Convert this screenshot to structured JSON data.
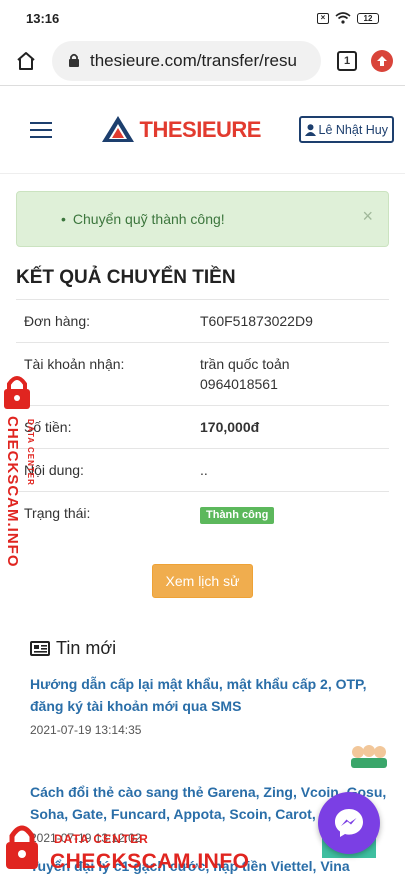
{
  "status_bar": {
    "time": "13:16",
    "battery": "12"
  },
  "browser": {
    "url": "thesieure.com/transfer/resu",
    "tab_count": "1"
  },
  "header": {
    "logo_text": "THESIEURE",
    "user_name": "Lê Nhật Huy"
  },
  "alert": {
    "message": "Chuyển quỹ thành công!",
    "close": "×"
  },
  "result": {
    "title": "KẾT QUẢ CHUYỂN TIỀN",
    "rows": [
      {
        "label": "Đơn hàng:",
        "value": "T60F51873022D9"
      },
      {
        "label": "Tài khoản nhận:",
        "value": "trần quốc toản",
        "value2": "0964018561"
      },
      {
        "label": "Số tiền:",
        "value": "170,000đ"
      },
      {
        "label": "Nội dung:",
        "value": ".."
      },
      {
        "label": "Trạng thái:",
        "value": "Thành công"
      }
    ],
    "history_button": "Xem lịch sử"
  },
  "news": {
    "heading": "Tin mới",
    "items": [
      {
        "title": "Hướng dẫn cấp lại mật khẩu, mật khẩu cấp 2, OTP, đăng ký tài khoản mới qua SMS",
        "time": "2021-07-19 13:14:35"
      },
      {
        "title": "Cách đổi thẻ cào sang thẻ Garena, Zing, Vcoin, Gosu, Soha, Gate, Funcard, Appota, Scoin, Carot, Giftcode",
        "time": "2021-07-19 13:12:02"
      },
      {
        "title": "Tuyển đại lý c1 gạch cước, nạp tiền Viettel, Vina"
      }
    ]
  },
  "watermark": {
    "big": "CHECKSCAM.INFO",
    "small": "DATA CENTER"
  },
  "colors": {
    "brand_navy": "#1d3f6e",
    "brand_red": "#e23b2f",
    "success": "#5cb85c",
    "warning": "#f0ad4e",
    "link": "#2a6ea8"
  }
}
